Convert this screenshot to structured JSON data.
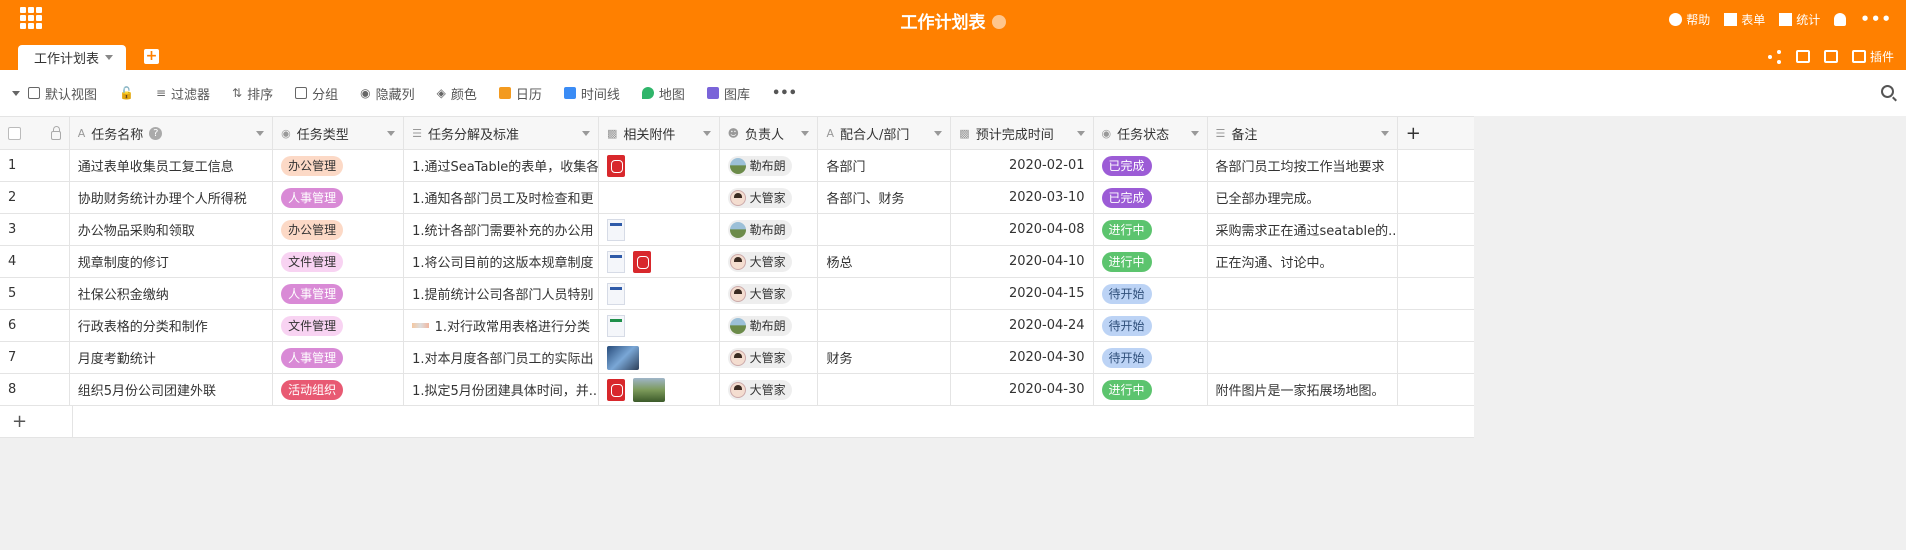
{
  "header": {
    "base_title": "工作计划表",
    "help": "帮助",
    "form": "表单",
    "stats": "统计",
    "plugins": "插件",
    "more": "•••"
  },
  "tab": {
    "name": "工作计划表",
    "add": "+"
  },
  "toolbar": {
    "view": "默认视图",
    "filter": "过滤器",
    "sort": "排序",
    "group": "分组",
    "hide": "隐藏列",
    "color": "颜色",
    "calendar": "日历",
    "timeline": "时间线",
    "map": "地图",
    "gallery": "图库",
    "more": "•••"
  },
  "columns": [
    "任务名称",
    "任务类型",
    "任务分解及标准",
    "相关附件",
    "负责人",
    "配合人/部门",
    "预计完成时间",
    "任务状态",
    "备注"
  ],
  "tag_colors": {
    "办公管理": "#fcd9c6",
    "人事管理": "#d98ad6",
    "文件管理": "#f8d3f2",
    "活动组织": "#e85a73"
  },
  "status_colors": {
    "已完成": "#9c5cd6",
    "进行中": "#5cc46e",
    "待开始": "#bcd3f5"
  },
  "rows": [
    {
      "n": "1",
      "name": "通过表单收集员工复工信息",
      "type": "办公管理",
      "detail": "1.通过SeaTable的表单，收集各",
      "att": [
        "pdf"
      ],
      "owner": "勒布朗",
      "owner_av": "bl",
      "partner": "各部门",
      "date": "2020-02-01",
      "status": "已完成",
      "note": "各部门员工均按工作当地要求"
    },
    {
      "n": "2",
      "name": "协助财务统计办理个人所得税",
      "type": "人事管理",
      "detail": "1.通知各部门员工及时检查和更",
      "att": [],
      "owner": "大管家",
      "owner_av": "dg",
      "partner": "各部门、财务",
      "date": "2020-03-10",
      "status": "已完成",
      "note": "已全部办理完成。"
    },
    {
      "n": "3",
      "name": "办公物品采购和领取",
      "type": "办公管理",
      "detail": "1.统计各部门需要补充的办公用",
      "att": [
        "doc"
      ],
      "owner": "勒布朗",
      "owner_av": "bl",
      "partner": "",
      "date": "2020-04-08",
      "status": "进行中",
      "note": "采购需求正在通过seatable的.."
    },
    {
      "n": "4",
      "name": "规章制度的修订",
      "type": "文件管理",
      "detail": "1.将公司目前的这版本规章制度",
      "att": [
        "doc",
        "pdf"
      ],
      "owner": "大管家",
      "owner_av": "dg",
      "partner": "杨总",
      "date": "2020-04-10",
      "status": "进行中",
      "note": "正在沟通、讨论中。"
    },
    {
      "n": "5",
      "name": "社保公积金缴纳",
      "type": "人事管理",
      "detail": "1.提前统计公司各部门人员特别",
      "att": [
        "doc"
      ],
      "owner": "大管家",
      "owner_av": "dg",
      "partner": "",
      "date": "2020-04-15",
      "status": "待开始",
      "note": ""
    },
    {
      "n": "6",
      "name": "行政表格的分类和制作",
      "type": "文件管理",
      "detail": "1.对行政常用表格进行分类",
      "detail_thumb": true,
      "att": [
        "docg"
      ],
      "owner": "勒布朗",
      "owner_av": "bl",
      "partner": "",
      "date": "2020-04-24",
      "status": "待开始",
      "note": ""
    },
    {
      "n": "7",
      "name": "月度考勤统计",
      "type": "人事管理",
      "detail": "1.对本月度各部门员工的实际出",
      "att": [
        "imga"
      ],
      "owner": "大管家",
      "owner_av": "dg",
      "partner": "财务",
      "date": "2020-04-30",
      "status": "待开始",
      "note": ""
    },
    {
      "n": "8",
      "name": "组织5月份公司团建外联",
      "type": "活动组织",
      "detail": "1.拟定5月份团建具体时间，并..",
      "att": [
        "pdf",
        "imgb"
      ],
      "owner": "大管家",
      "owner_av": "dg",
      "partner": "",
      "date": "2020-04-30",
      "status": "进行中",
      "note": "附件图片是一家拓展场地图。"
    }
  ],
  "add_row": "+",
  "add_col": "+"
}
